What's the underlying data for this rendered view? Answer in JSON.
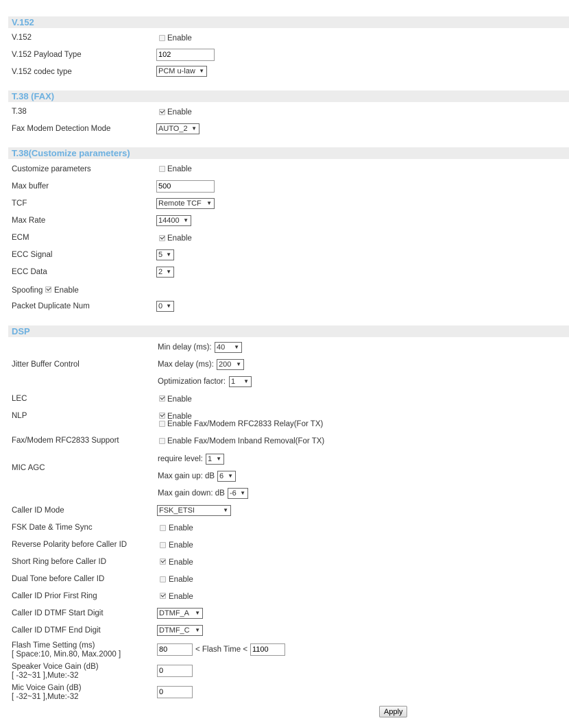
{
  "v152": {
    "header": "V.152",
    "v152_label": "V.152",
    "v152_enable": "Enable",
    "payload_label": "V.152 Payload Type",
    "payload_value": "102",
    "codec_label": "V.152 codec type",
    "codec_value": "PCM u-law"
  },
  "t38": {
    "header": "T.38 (FAX)",
    "t38_label": "T.38",
    "t38_enable": "Enable",
    "fax_mode_label": "Fax Modem Detection Mode",
    "fax_mode_value": "AUTO_2"
  },
  "t38c": {
    "header": "T.38(Customize parameters)",
    "custom_label": "Customize parameters",
    "custom_enable": "Enable",
    "max_buffer_label": "Max buffer",
    "max_buffer_value": "500",
    "tcf_label": "TCF",
    "tcf_value": "Remote TCF",
    "max_rate_label": "Max Rate",
    "max_rate_value": "14400",
    "ecm_label": "ECM",
    "ecm_enable": "Enable",
    "ecc_signal_label": "ECC Signal",
    "ecc_signal_value": "5",
    "ecc_data_label": "ECC Data",
    "ecc_data_value": "2",
    "spoofing_label": "Spoofing",
    "spoofing_enable": "Enable",
    "packet_dup_label": "Packet Duplicate Num",
    "packet_dup_value": "0"
  },
  "dsp": {
    "header": "DSP",
    "jitter_label": "Jitter Buffer Control",
    "min_delay_label": "Min delay (ms):",
    "min_delay_value": "40",
    "max_delay_label": "Max delay (ms):",
    "max_delay_value": "200",
    "opt_label": "Optimization factor:",
    "opt_value": "1",
    "lec_label": "LEC",
    "lec_enable": "Enable",
    "nlp_label": "NLP",
    "nlp_enable": "Enable",
    "rfc_relay": "Enable Fax/Modem RFC2833 Relay(For TX)",
    "rfc_support_label": "Fax/Modem RFC2833 Support",
    "inband_removal": "Enable Fax/Modem Inband Removal(For TX)",
    "mic_agc_label": "MIC AGC",
    "require_level_label": "require level:",
    "require_level_value": "1",
    "max_gain_up_label": "Max gain up: dB",
    "max_gain_up_value": "6",
    "max_gain_down_label": "Max gain down: dB",
    "max_gain_down_value": "-6",
    "caller_id_mode_label": "Caller ID Mode",
    "caller_id_mode_value": "FSK_ETSI",
    "fsk_sync_label": "FSK Date & Time Sync",
    "fsk_sync_enable": "Enable",
    "reverse_label": "Reverse Polarity before Caller ID",
    "reverse_enable": "Enable",
    "short_ring_label": "Short Ring before Caller ID",
    "short_ring_enable": "Enable",
    "dual_tone_label": "Dual Tone before Caller ID",
    "dual_tone_enable": "Enable",
    "prior_ring_label": "Caller ID Prior First Ring",
    "prior_ring_enable": "Enable",
    "dtmf_start_label": "Caller ID DTMF Start Digit",
    "dtmf_start_value": "DTMF_A",
    "dtmf_end_label": "Caller ID DTMF End Digit",
    "dtmf_end_value": "DTMF_C",
    "flash_label": "Flash Time Setting (ms)",
    "flash_hint": "[ Space:10, Min.80, Max.2000 ]",
    "flash_min_value": "80",
    "flash_between": "< Flash Time <",
    "flash_max_value": "1100",
    "speaker_label": "Speaker Voice Gain (dB)",
    "speaker_hint": "[ -32~31 ],Mute:-32",
    "speaker_value": "0",
    "mic_label": "Mic Voice Gain (dB)",
    "mic_hint": "[ -32~31 ],Mute:-32",
    "mic_value": "0"
  },
  "apply_label": "Apply",
  "colors": {
    "section_bg": "#ececec",
    "section_title": "#6cb0e0"
  },
  "checkbox_states": {
    "v152": false,
    "t38": true,
    "customize": false,
    "ecm": true,
    "spoofing": true,
    "lec": true,
    "nlp": true,
    "rfc_relay": false,
    "inband_removal": false,
    "fsk_sync": false,
    "reverse": false,
    "short_ring": true,
    "dual_tone": false,
    "prior_ring": true
  }
}
